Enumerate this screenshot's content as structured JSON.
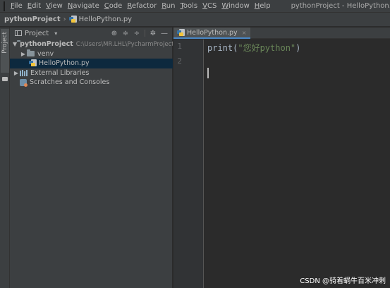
{
  "app": {
    "logo_icon": "pycharm-logo-icon",
    "window_title": "pythonProject - HelloPython.py"
  },
  "menu": [
    "File",
    "Edit",
    "View",
    "Navigate",
    "Code",
    "Refactor",
    "Run",
    "Tools",
    "VCS",
    "Window",
    "Help"
  ],
  "breadcrumb": {
    "project": "pythonProject",
    "separator": "›",
    "file": "HelloPython.py"
  },
  "sidebar_stripe": {
    "project_tab": "Project"
  },
  "project_panel": {
    "title": "Project",
    "dropdown": "▾",
    "tools": [
      "⊕",
      "≑",
      "÷",
      "✲",
      "—"
    ],
    "tree": [
      {
        "label": "pythonProject",
        "path": "C:\\Users\\MR.LHL\\PycharmProjects\\p",
        "expanded": true
      },
      {
        "label": "venv",
        "expanded": false
      },
      {
        "label": "HelloPython.py",
        "selected": true
      },
      {
        "label": "External Libraries",
        "expanded": false
      },
      {
        "label": "Scratches and Consoles"
      }
    ]
  },
  "editor": {
    "tab_label": "HelloPython.py",
    "tab_close": "×",
    "line_numbers": [
      "1",
      "2"
    ],
    "code": {
      "func": "print",
      "open": "(",
      "string": "\"您好python\"",
      "close": ")"
    }
  },
  "colors": {
    "menubar_bg": "#3c3f41",
    "editor_bg": "#2b2b2b",
    "selection_bg": "#0d293e",
    "string_green": "#6a8759",
    "tab_underline": "#4a88c7"
  },
  "watermark": "CSDN @骑着蜗牛百米冲刺"
}
